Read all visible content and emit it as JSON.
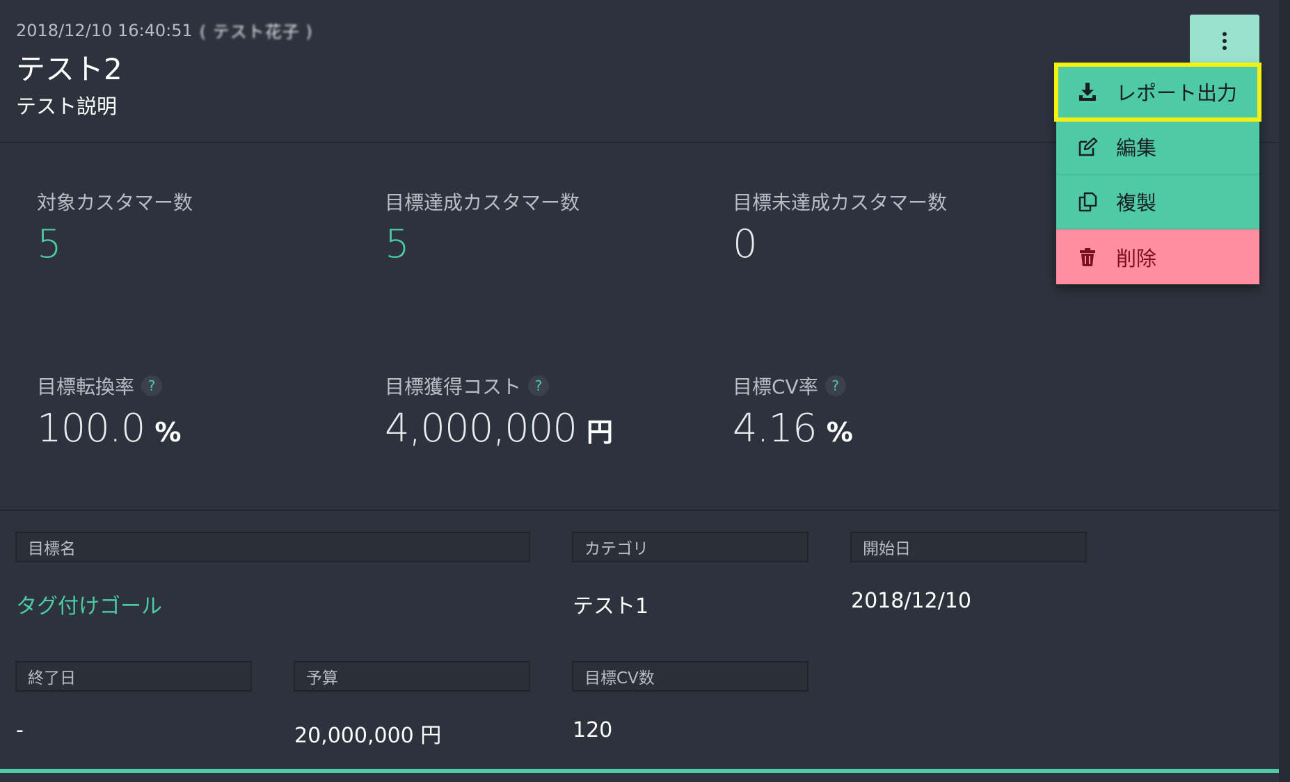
{
  "header": {
    "timestamp": "2018/12/10 16:40:51",
    "author_redacted": "( テスト花子 )",
    "title": "テスト2",
    "description": "テスト説明"
  },
  "menu": {
    "items": [
      {
        "label": "レポート出力",
        "icon": "download-icon"
      },
      {
        "label": "編集",
        "icon": "edit-icon"
      },
      {
        "label": "複製",
        "icon": "copy-icon"
      },
      {
        "label": "削除",
        "icon": "trash-icon"
      }
    ]
  },
  "stats": {
    "target_customers": {
      "label": "対象カスタマー数",
      "value": "5"
    },
    "achieved_customers": {
      "label": "目標達成カスタマー数",
      "value": "5"
    },
    "unachieved_customers": {
      "label": "目標未達成カスタマー数",
      "value": "0"
    },
    "conversion_rate": {
      "label": "目標転換率",
      "value": "100.0",
      "unit": "%"
    },
    "acquisition_cost": {
      "label": "目標獲得コスト",
      "value": "4,000,000",
      "unit": "円"
    },
    "cv_rate": {
      "label": "目標CV率",
      "value": "4.16",
      "unit": "%"
    },
    "help_glyph": "?"
  },
  "details": {
    "goal_name": {
      "label": "目標名",
      "value": "タグ付けゴール"
    },
    "category": {
      "label": "カテゴリ",
      "value": "テスト1"
    },
    "start_date": {
      "label": "開始日",
      "value": "2018/12/10"
    },
    "end_date": {
      "label": "終了日",
      "value": "-"
    },
    "budget": {
      "label": "予算",
      "value": "20,000,000 円"
    },
    "target_cv": {
      "label": "目標CV数",
      "value": "120"
    }
  },
  "colors": {
    "accent": "#4ecba5",
    "danger": "#ff8fa0",
    "highlight": "#f4f012",
    "background": "#2d333d"
  }
}
